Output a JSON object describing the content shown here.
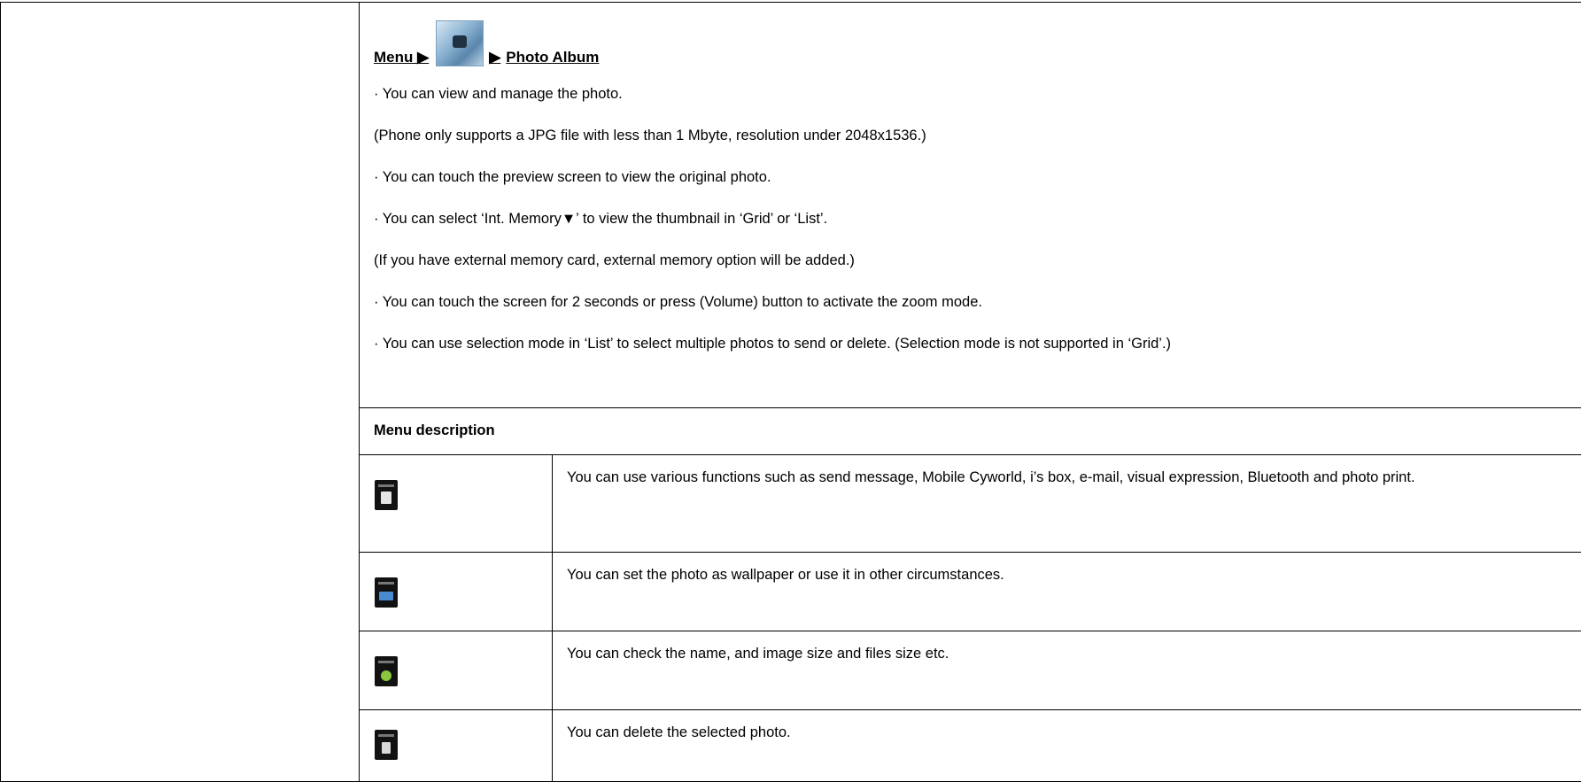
{
  "section": {
    "heading_menu": "Menu ▶",
    "heading_arrow": "▶",
    "heading_title": "Photo Album",
    "thumbnail_icon": "photo-album-thumb-icon"
  },
  "intro_lines": [
    "· You can view and manage the photo.",
    "(Phone only supports a JPG file with less than 1 Mbyte, resolution under 2048x1536.)",
    "· You can touch the preview screen to view the original photo.",
    "· You can select ‘Int. Memory▼’ to view the thumbnail in ‘Grid’ or ‘List’.",
    "(If you have external memory card, external memory option will be added.)",
    "· You can touch the screen for 2 seconds or press (Volume) button to activate the zoom mode.",
    "· You can use selection mode in ‘List’ to select multiple photos to send or delete. (Selection mode is not supported in ‘Grid’.)"
  ],
  "menu_description": {
    "header": "Menu description",
    "rows": [
      {
        "icon": "send-icon",
        "text": "You can use various functions such as send message, Mobile Cyworld, i’s box, e-mail, visual expression, Bluetooth and photo print."
      },
      {
        "icon": "settings-icon",
        "text": "You can set the photo as wallpaper or use it in other circumstances."
      },
      {
        "icon": "info-icon",
        "text": "You can check the name, and image size and files size etc."
      },
      {
        "icon": "delete-icon",
        "text": "You can delete the selected photo."
      }
    ]
  }
}
